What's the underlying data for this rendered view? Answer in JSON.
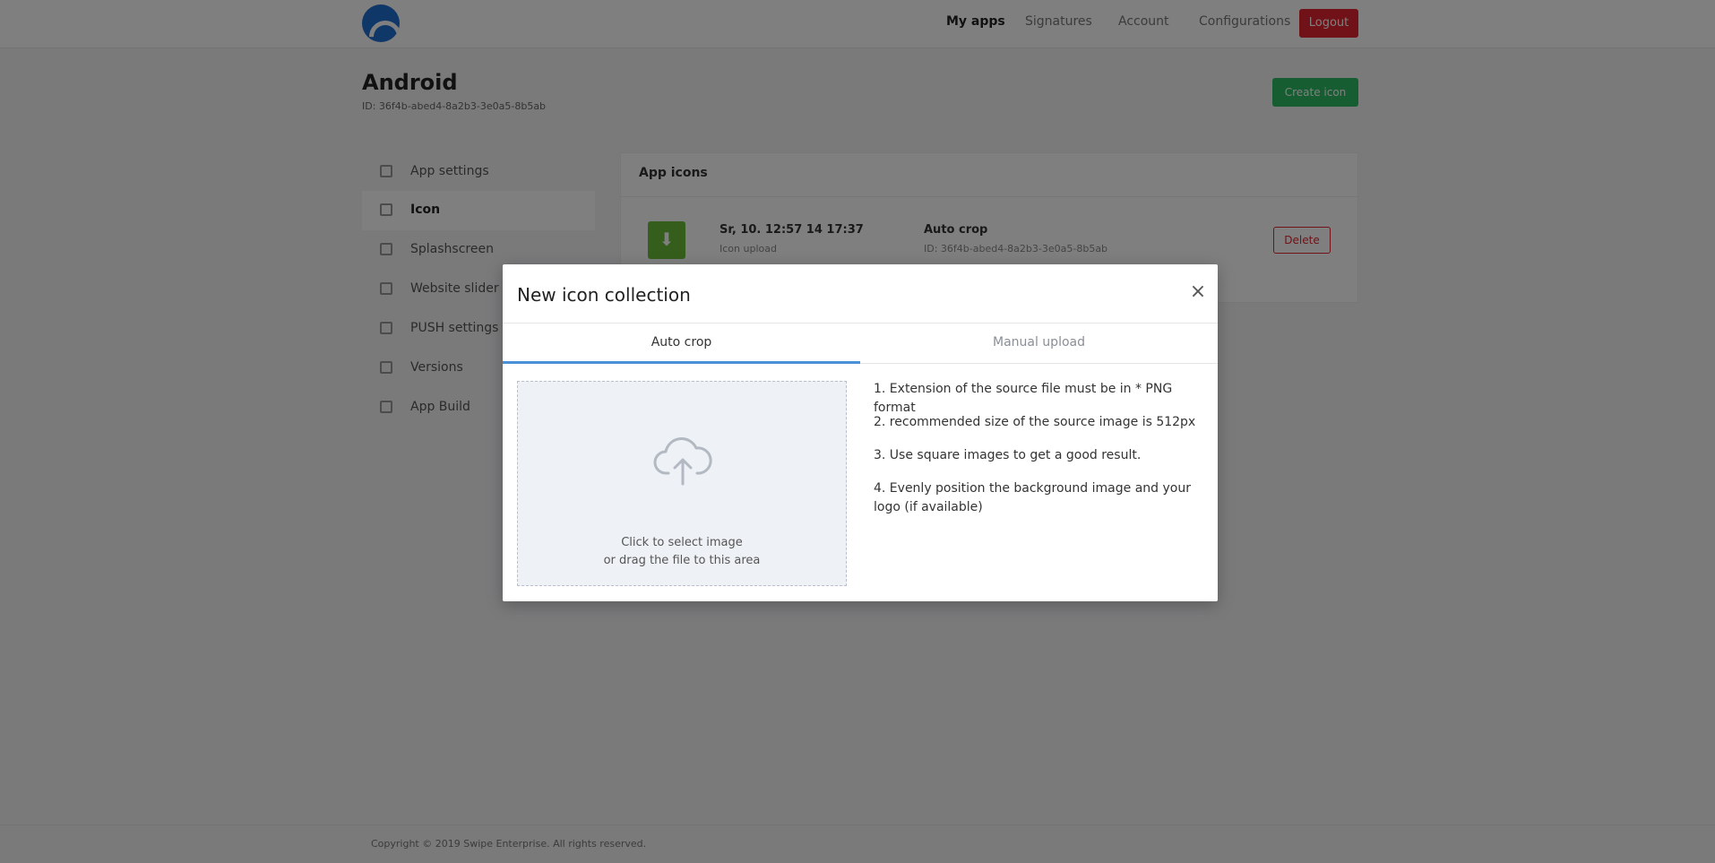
{
  "colors": {
    "overlay": "rgba(0,0,0,0.5)",
    "tab_accent": "#4a90d9",
    "dropzone_bg": "#eef1f5",
    "logout": "#e0242f",
    "green": "#2dbd62"
  },
  "background": {
    "nav": [
      "My apps",
      "Signatures",
      "Account",
      "Configurations"
    ],
    "logout_label": "Logout",
    "app": {
      "title": "Android",
      "subtitle": "ID: 36f4b-abed4-8a2b3-3e0a5-8b5ab",
      "green_button": "Create icon"
    },
    "sidebar": [
      {
        "label": "App settings",
        "icon": "gear-icon"
      },
      {
        "label": "Icon",
        "icon": "image-icon"
      },
      {
        "label": "Splashscreen",
        "icon": "phone-icon"
      },
      {
        "label": "Website slider",
        "icon": "link-icon"
      },
      {
        "label": "PUSH settings",
        "icon": "bell-icon"
      },
      {
        "label": "Versions",
        "icon": "list-icon"
      },
      {
        "label": "App Build",
        "icon": "wrench-icon"
      }
    ],
    "panel": {
      "heading": "App icons",
      "date": "Sr, 10. 12:57 14 17:37",
      "date_sub": "Icon upload",
      "crop_title": "Auto crop",
      "crop_sub": "ID: 36f4b-abed4-8a2b3-3e0a5-8b5ab",
      "delete_label": "Delete"
    },
    "footer": "Copyright © 2019 Swipe Enterprise. All rights reserved."
  },
  "modal": {
    "title": "New icon collection",
    "close_icon": "×",
    "tabs": [
      {
        "label": "Auto crop",
        "active": true
      },
      {
        "label": "Manual upload",
        "active": false
      }
    ],
    "dropzone": {
      "icon": "cloud-upload-icon",
      "line1": "Click to select image",
      "line2": "or drag the file to this area"
    },
    "instructions": [
      "1. Extension of the source file must be in * PNG format",
      "2. recommended size of the source image is 512px",
      "3. Use square images to get a good result.",
      "4. Evenly position the background image and your logo (if available)"
    ]
  }
}
